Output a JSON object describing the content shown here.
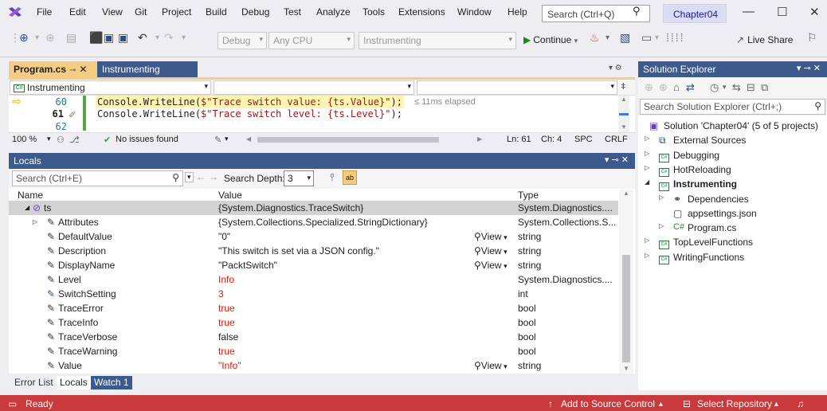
{
  "menu": {
    "items": [
      "File",
      "Edit",
      "View",
      "Git",
      "Project",
      "Build",
      "Debug",
      "Test",
      "Analyze",
      "Tools",
      "Extensions",
      "Window",
      "Help"
    ],
    "search_placeholder": "Search (Ctrl+Q)",
    "solution_name": "Chapter04"
  },
  "toolbar": {
    "config": "Debug",
    "platform": "Any CPU",
    "project": "Instrumenting",
    "continue": "Continue",
    "live_share": "Live Share"
  },
  "editor": {
    "tabs": [
      {
        "label": "Program.cs",
        "active": true
      },
      {
        "label": "Instrumenting",
        "active": false
      }
    ],
    "nav_project": "Instrumenting",
    "line_numbers": [
      "60",
      "61",
      "62"
    ],
    "lines": [
      {
        "prefix": "Console.WriteLine(",
        "string": "$\"Trace switch value: {ts.Value}\"",
        "suffix": ");"
      },
      {
        "prefix": "Console.WriteLine(",
        "string": "$\"Trace switch level: {ts.Level}\"",
        "suffix": ");"
      }
    ],
    "elapsed": "≤ 11ms elapsed",
    "status": {
      "zoom": "100 %",
      "issues": "No issues found",
      "line": "Ln: 61",
      "column": "Ch: 4",
      "spacing": "SPC",
      "eol": "CRLF"
    }
  },
  "locals": {
    "title": "Locals",
    "search_placeholder": "Search (Ctrl+E)",
    "search_depth_label": "Search Depth:",
    "search_depth": "3",
    "columns": {
      "name": "Name",
      "value": "Value",
      "type": "Type"
    },
    "view_label": "View",
    "rows": [
      {
        "name": "ts",
        "value": "{System.Diagnostics.TraceSwitch}",
        "type": "System.Diagnostics....",
        "view": false,
        "changed": false
      },
      {
        "name": "Attributes",
        "value": "{System.Collections.Specialized.StringDictionary}",
        "type": "System.Collections.S...",
        "view": false,
        "changed": false
      },
      {
        "name": "DefaultValue",
        "value": "\"0\"",
        "type": "string",
        "view": true,
        "changed": false
      },
      {
        "name": "Description",
        "value": "\"This switch is set via a JSON config.\"",
        "type": "string",
        "view": true,
        "changed": false
      },
      {
        "name": "DisplayName",
        "value": "\"PacktSwitch\"",
        "type": "string",
        "view": true,
        "changed": false
      },
      {
        "name": "Level",
        "value": "Info",
        "type": "System.Diagnostics....",
        "view": false,
        "changed": true
      },
      {
        "name": "SwitchSetting",
        "value": "3",
        "type": "int",
        "view": false,
        "changed": true
      },
      {
        "name": "TraceError",
        "value": "true",
        "type": "bool",
        "view": false,
        "changed": true
      },
      {
        "name": "TraceInfo",
        "value": "true",
        "type": "bool",
        "view": false,
        "changed": true
      },
      {
        "name": "TraceVerbose",
        "value": "false",
        "type": "bool",
        "view": false,
        "changed": false
      },
      {
        "name": "TraceWarning",
        "value": "true",
        "type": "bool",
        "view": false,
        "changed": true
      },
      {
        "name": "Value",
        "value": "\"Info\"",
        "type": "string",
        "view": true,
        "changed": true
      }
    ],
    "bottom_tabs": [
      {
        "label": "Error List",
        "active": false
      },
      {
        "label": "Locals",
        "active": true
      },
      {
        "label": "Watch 1",
        "active": false
      }
    ]
  },
  "solution_explorer": {
    "title": "Solution Explorer",
    "search_placeholder": "Search Solution Explorer (Ctrl+;)",
    "nodes": [
      {
        "label": "Solution 'Chapter04' (5 of 5 projects)",
        "indent": 0,
        "kind": "solution",
        "expander": ""
      },
      {
        "label": "External Sources",
        "indent": 1,
        "kind": "external",
        "expander": "▷"
      },
      {
        "label": "Debugging",
        "indent": 1,
        "kind": "project",
        "expander": "▷"
      },
      {
        "label": "HotReloading",
        "indent": 1,
        "kind": "project",
        "expander": "▷"
      },
      {
        "label": "Instrumenting",
        "indent": 1,
        "kind": "project",
        "expander": "◢",
        "bold": true
      },
      {
        "label": "Dependencies",
        "indent": 2,
        "kind": "deps",
        "expander": "▷"
      },
      {
        "label": "appsettings.json",
        "indent": 2,
        "kind": "json",
        "expander": ""
      },
      {
        "label": "Program.cs",
        "indent": 2,
        "kind": "cs",
        "expander": "▷"
      },
      {
        "label": "TopLevelFunctions",
        "indent": 1,
        "kind": "project",
        "expander": "▷"
      },
      {
        "label": "WritingFunctions",
        "indent": 1,
        "kind": "project",
        "expander": "▷"
      }
    ]
  },
  "statusbar": {
    "state": "Ready",
    "source_control": "Add to Source Control",
    "repository": "Select Repository"
  },
  "colors": {
    "accent_blue": "#3d5a8c",
    "active_tab": "#f5cc84",
    "status_bar": "#c8393c",
    "changed_value": "#e51400"
  }
}
